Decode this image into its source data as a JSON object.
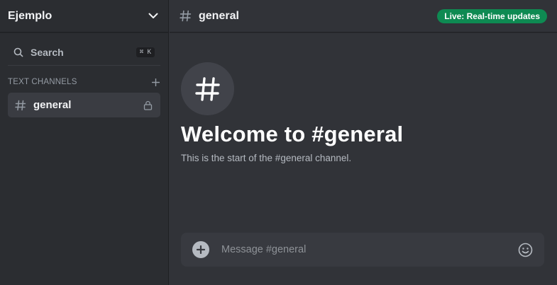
{
  "server": {
    "name": "Ejemplo"
  },
  "search": {
    "label": "Search",
    "shortcut": "⌘ K"
  },
  "sidebar": {
    "category_label": "TEXT CHANNELS",
    "channels": [
      {
        "name": "general",
        "locked": true,
        "selected": true
      }
    ]
  },
  "header": {
    "channel_name": "general",
    "live_badge": "Live: Real-time updates"
  },
  "welcome": {
    "title": "Welcome to #general",
    "subtitle": "This is the start of the #general channel."
  },
  "composer": {
    "placeholder": "Message #general"
  },
  "colors": {
    "live_badge": "#0e8a52",
    "selected_channel": "#3a3c42"
  }
}
